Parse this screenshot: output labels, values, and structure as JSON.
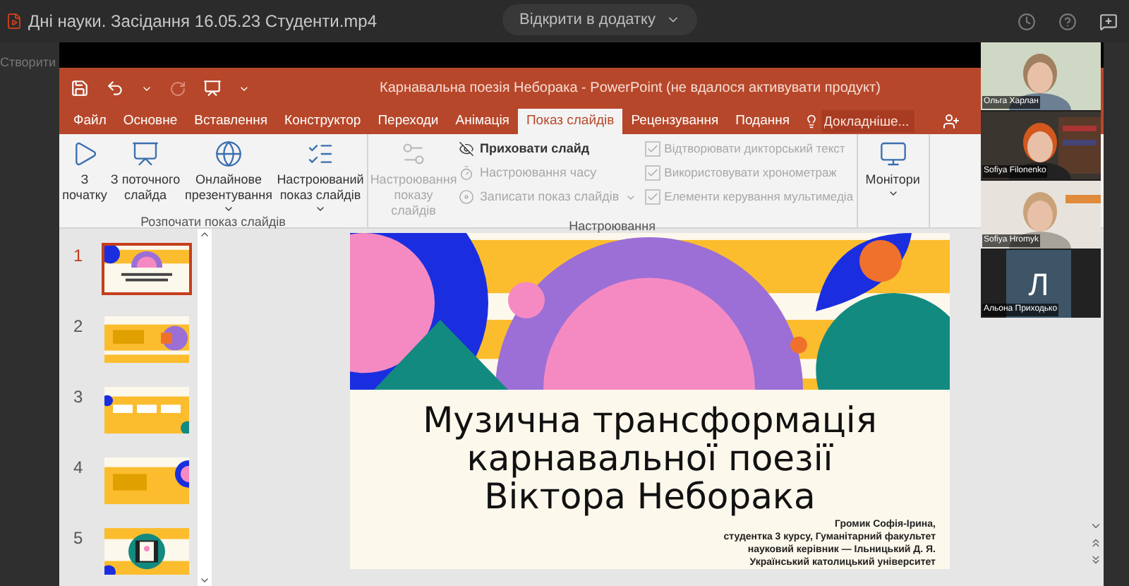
{
  "player": {
    "file_title": "Дні науки. Засідання 16.05.23 Студенти.mp4",
    "open_button": "Відкрити в додатку",
    "side_label": "Створити"
  },
  "powerpoint": {
    "title": "Карнавальна поезія Неборака - PowerPoint (не вдалося активувати продукт)",
    "tabs": [
      {
        "label": "Файл",
        "selected": false
      },
      {
        "label": "Основне",
        "selected": false
      },
      {
        "label": "Вставлення",
        "selected": false
      },
      {
        "label": "Конструктор",
        "selected": false
      },
      {
        "label": "Переходи",
        "selected": false
      },
      {
        "label": "Анімація",
        "selected": false
      },
      {
        "label": "Показ слайдів",
        "selected": true
      },
      {
        "label": "Рецензування",
        "selected": false
      },
      {
        "label": "Подання",
        "selected": false
      }
    ],
    "search": {
      "placeholder": "Докладніше..."
    },
    "ribbon": [
      {
        "label": "Розпочати показ слайдів",
        "items": [
          {
            "kind": "big",
            "label": "З початку",
            "disabled": false,
            "dropdown": false
          },
          {
            "kind": "big",
            "label": "З поточного слайда",
            "disabled": false,
            "dropdown": false
          },
          {
            "kind": "big",
            "label": "Онлайнове презентування",
            "disabled": false,
            "dropdown": true
          },
          {
            "kind": "big",
            "label": "Настроюваний показ слайдів",
            "disabled": false,
            "dropdown": true
          }
        ]
      },
      {
        "label": "Настроювання",
        "items": [
          {
            "kind": "big",
            "label": "Настроювання показу слайдів",
            "disabled": true,
            "dropdown": false
          },
          {
            "kind": "small",
            "label": "Приховати слайд",
            "disabled": false,
            "dropdown": false
          },
          {
            "kind": "small",
            "label": "Настроювання часу",
            "disabled": true,
            "dropdown": false
          },
          {
            "kind": "small",
            "label": "Записати показ слайдів",
            "disabled": true,
            "dropdown": true
          },
          {
            "kind": "check",
            "label": "Відтворювати дикторський текст",
            "disabled": true,
            "checked": true
          },
          {
            "kind": "check",
            "label": "Використовувати хронометраж",
            "disabled": true,
            "checked": true
          },
          {
            "kind": "check",
            "label": "Елементи керування мультимедіа",
            "disabled": true,
            "checked": true
          }
        ]
      },
      {
        "items": [
          {
            "kind": "big",
            "label": "Монітори",
            "disabled": false,
            "dropdown": true
          }
        ]
      }
    ],
    "thumbnails": [
      {
        "number": "1",
        "selected": true
      },
      {
        "number": "2",
        "selected": false
      },
      {
        "number": "3",
        "selected": false
      },
      {
        "number": "4",
        "selected": false
      },
      {
        "number": "5",
        "selected": false
      }
    ],
    "slide": {
      "title_lines": [
        "Музична трансформація",
        "карнавальної поезії",
        "Віктора Неборака"
      ],
      "author_lines": [
        "Громик Софія-Ірина,",
        "студентка 3 курсу, Гуманітарний факультет",
        "науковий керівник — Ільницький Д. Я.",
        "Український католицький університет"
      ]
    }
  },
  "participants": [
    {
      "name": "Ольга Харлан",
      "kind": "video"
    },
    {
      "name": "Sofiya Filonenko",
      "kind": "video"
    },
    {
      "name": "Sofiya Hromyk",
      "kind": "video"
    },
    {
      "name": "Альона Приходько",
      "kind": "avatar",
      "initial": "Л"
    }
  ]
}
